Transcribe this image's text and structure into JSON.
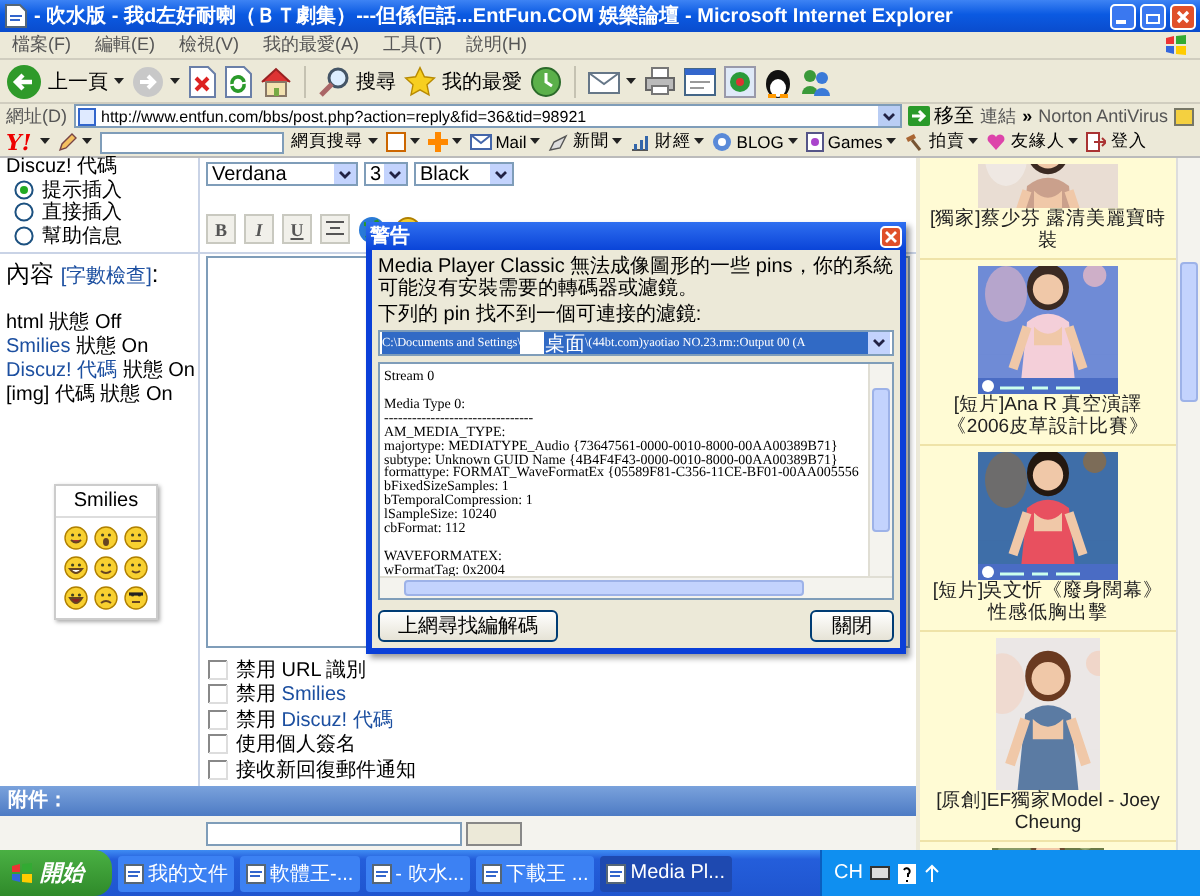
{
  "window": {
    "title": "- 吹水版 - 我d左好耐喇（ＢＴ劇集）---但係佢話...EntFun.COM 娛樂論壇 - Microsoft Internet Explorer"
  },
  "menu": [
    "檔案(F)",
    "編輯(E)",
    "檢視(V)",
    "我的最愛(A)",
    "工具(T)",
    "說明(H)"
  ],
  "toolbar": {
    "back": "上一頁",
    "search": "搜尋",
    "favorites": "我的最愛"
  },
  "address": {
    "label": "網址(D)",
    "url": "http://www.entfun.com/bbs/post.php?action=reply&fid=36&tid=98921",
    "go": "移至",
    "links": "連結",
    "more": "»",
    "norton": "Norton AntiVirus"
  },
  "yahoo_bar": {
    "logo": "Y!",
    "search_button": "網頁搜尋",
    "items": [
      "Mail",
      "新聞",
      "財經",
      "BLOG",
      "Games",
      "拍賣",
      "友緣人",
      "登入"
    ]
  },
  "post_form": {
    "code_heading": "Discuz! 代碼",
    "code_modes": [
      {
        "label": "提示插入",
        "selected": true
      },
      {
        "label": "直接插入",
        "selected": false
      },
      {
        "label": "幫助信息",
        "selected": false
      }
    ],
    "content_label": "內容",
    "count_link": "[字數檢查]",
    "count_suffix": ":",
    "status_lines": [
      {
        "kind": "plain",
        "text": "html 狀態 Off"
      },
      {
        "kind": "link",
        "link": "Smilies",
        "text": "狀態 On"
      },
      {
        "kind": "link",
        "link": "Discuz! 代碼",
        "text": "狀態 On"
      },
      {
        "kind": "plain",
        "text": "[img] 代碼 狀態 On"
      }
    ],
    "smilies_title": "Smilies",
    "font": "Verdana",
    "size": "3",
    "color_select": "Black",
    "format_buttons": [
      "B",
      "I",
      "U"
    ],
    "options": [
      {
        "kind": "plain",
        "text": "禁用 URL 識別",
        "checked": false
      },
      {
        "kind": "link",
        "text": "禁用",
        "link": "Smilies",
        "checked": false
      },
      {
        "kind": "link",
        "text": "禁用",
        "link": "Discuz! 代碼",
        "checked": false
      },
      {
        "kind": "plain",
        "text": "使用個人簽名",
        "checked": false
      },
      {
        "kind": "plain",
        "text": "接收新回復郵件通知",
        "checked": false
      }
    ],
    "attachments_label": "附件："
  },
  "sidebar": [
    {
      "caption": "[獨家]蔡少芬 露清美麗寶時裝",
      "video": false
    },
    {
      "caption": "[短片]Ana R 真空演譯《2006皮草設計比賽》",
      "video": true
    },
    {
      "caption": "[短片]吳文忻《廢身闊幕》性感低胸出擊",
      "video": true
    },
    {
      "caption": "[原創]EF獨家Model - Joey Cheung",
      "video": false
    }
  ],
  "dialog": {
    "title": "警告",
    "message": "Media Player Classic 無法成像圖形的一些 pins，你的系統可能沒有安裝需要的轉碼器或濾鏡。",
    "prompt": "下列的 pin 找不到一個可連接的濾鏡:",
    "pin_path_start": "C:\\Documents and Settings\\",
    "pin_folder": "桌面",
    "pin_path_end": "\\(44bt.com)yaotiao NO.23.rm::Output 00 (A",
    "details": [
      [
        "Stream 0"
      ],
      [
        "Media Type 0:",
        "--------------------------------",
        "AM_MEDIA_TYPE:",
        "majortype: MEDIATYPE_Audio {73647561-0000-0010-8000-00AA00389B71}",
        "subtype: Unknown GUID Name {4B4F4F43-0000-0010-8000-00AA00389B71}",
        "formattype: FORMAT_WaveFormatEx {05589F81-C356-11CE-BF01-00AA005556",
        "bFixedSizeSamples: 1",
        "bTemporalCompression: 1",
        "lSampleSize: 10240",
        "cbFormat: 112"
      ],
      [
        "WAVEFORMATEX:",
        "wFormatTag: 0x2004"
      ]
    ],
    "search_button": "上網尋找編解碼",
    "close_button": "關閉"
  },
  "taskbar": {
    "start": "開始",
    "tasks": [
      {
        "label": "我的文件",
        "selected": false
      },
      {
        "label": "軟體王-...",
        "selected": false
      },
      {
        "label": "- 吹水...",
        "selected": false
      },
      {
        "label": "下載王 ...",
        "selected": false
      },
      {
        "label": "Media Pl...",
        "selected": true
      }
    ],
    "language": "CH"
  }
}
